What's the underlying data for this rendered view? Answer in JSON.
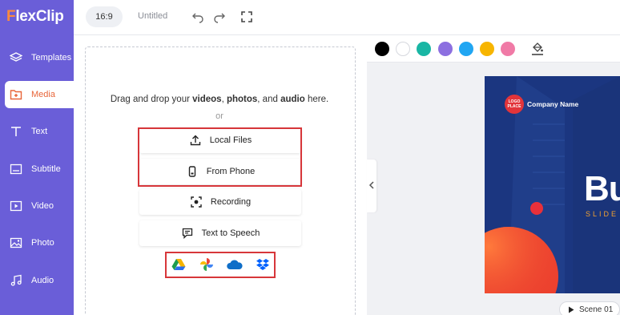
{
  "app": {
    "logo_letter": "F",
    "logo_rest": "lexClip"
  },
  "sidebar": {
    "items": [
      {
        "label": "Templates",
        "icon": "layers-icon"
      },
      {
        "label": "Media",
        "icon": "media-folder-icon",
        "active": true
      },
      {
        "label": "Text",
        "icon": "text-icon"
      },
      {
        "label": "Subtitle",
        "icon": "subtitle-icon"
      },
      {
        "label": "Video",
        "icon": "video-icon"
      },
      {
        "label": "Photo",
        "icon": "photo-icon"
      },
      {
        "label": "Audio",
        "icon": "audio-icon"
      }
    ]
  },
  "topbar": {
    "ratio": "16:9",
    "title": "Untitled"
  },
  "media": {
    "drag_prefix": "Drag and drop your",
    "videos": "videos",
    "comma1": ",",
    "photos": "photos",
    "comma2": ", and",
    "audio": "audio",
    "drag_suffix": "here.",
    "or": "or",
    "buttons": {
      "local_files": "Local Files",
      "from_phone": "From Phone",
      "recording": "Recording",
      "text_to_speech": "Text to Speech"
    },
    "cloud_sources": [
      "google-drive-icon",
      "google-photos-icon",
      "onedrive-icon",
      "dropbox-icon"
    ]
  },
  "colors": {
    "swatches": [
      "#000000",
      "#ffffff",
      "#19b6a4",
      "#8c6fe0",
      "#21a6f2",
      "#f7b500",
      "#f07aa6"
    ],
    "accent": "#e8663a",
    "sidebar": "#6a5ed8",
    "highlight": "#d7363a"
  },
  "preview": {
    "logo_badge": "LOGO PLACE",
    "company": "Company Name",
    "headline": "Bu",
    "subline": "SLIDE",
    "scene": "Scene 01"
  }
}
